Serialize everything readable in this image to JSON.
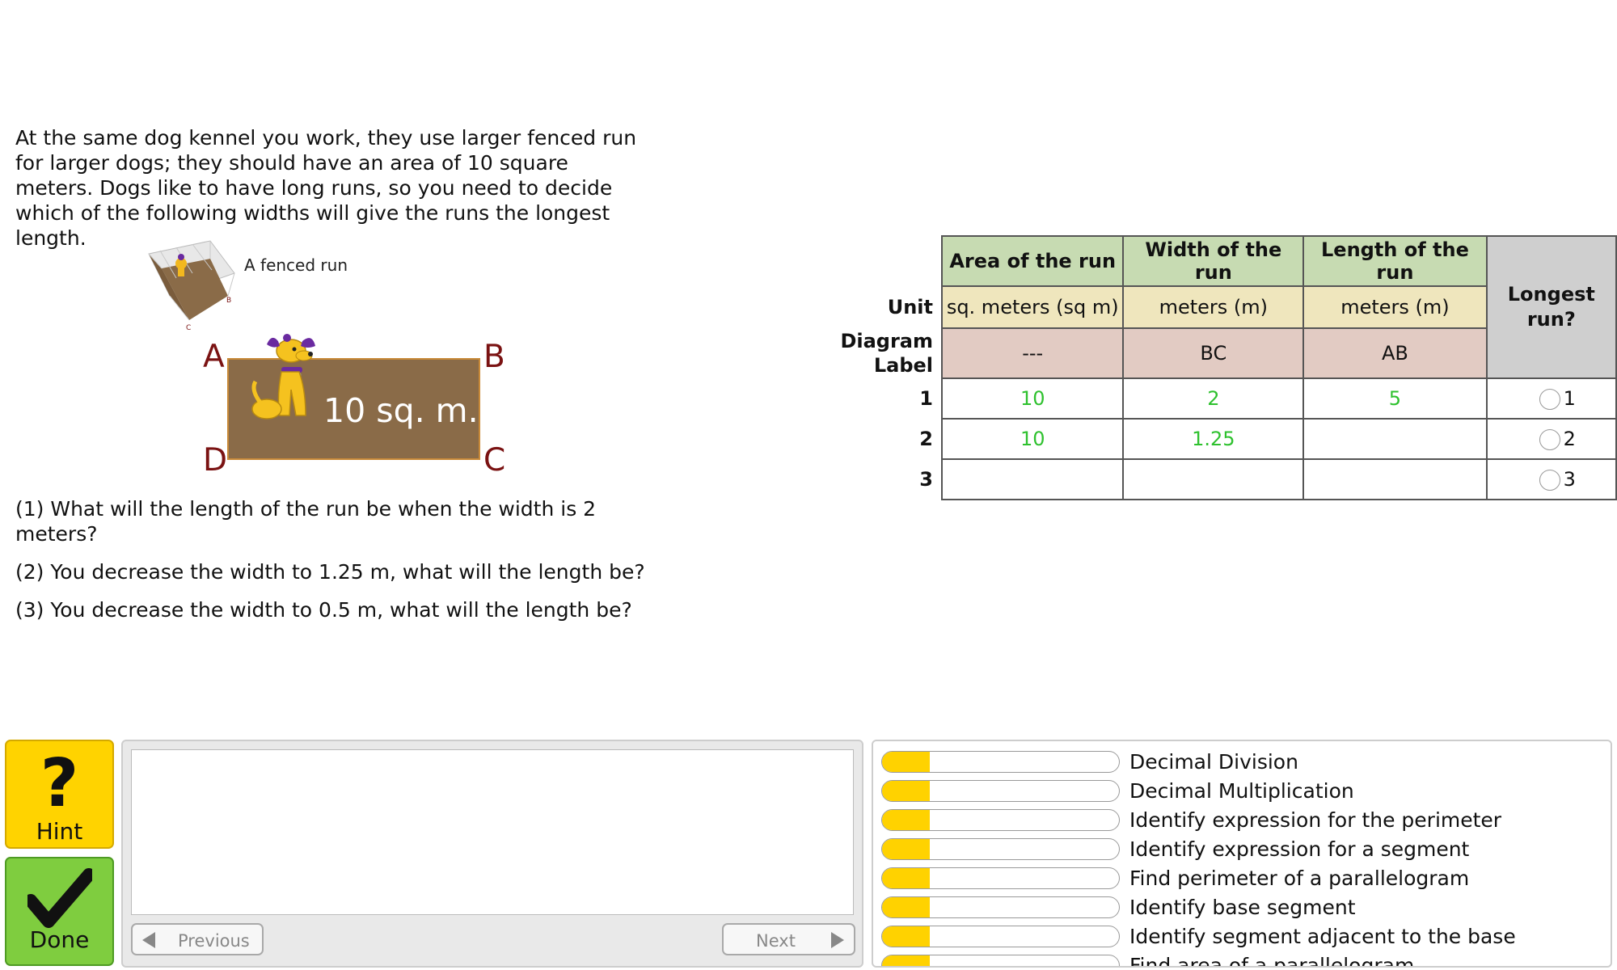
{
  "problem": {
    "intro": "At the same dog kennel you work, they use larger fenced run for larger dogs; they should have an area of 10 square meters. Dogs like to have long runs, so you need to decide which of the following widths will give the runs the longest length.",
    "thumbnail_caption": "A fenced run",
    "diagram": {
      "area_label": "10 sq. m.",
      "corners": {
        "a": "A",
        "b": "B",
        "c": "C",
        "d": "D"
      }
    },
    "questions": [
      "(1) What will the length of the run be when the width is 2 meters?",
      "(2) You decrease the width to 1.25 m, what will the length be?",
      "(3) You decrease the width to 0.5 m, what will the length be?"
    ]
  },
  "table": {
    "headers": {
      "area": "Area of the run",
      "width": "Width of the run",
      "length": "Length of the run",
      "longest": "Longest run?"
    },
    "unit_label": "Unit",
    "units": {
      "area": "sq. meters (sq m)",
      "width": "meters (m)",
      "length": "meters (m)"
    },
    "diagram_label": "Diagram Label",
    "diagram": {
      "area": "---",
      "width": "BC",
      "length": "AB"
    },
    "rows": [
      {
        "n": "1",
        "area": "10",
        "width": "2",
        "length": "5",
        "radio": "1"
      },
      {
        "n": "2",
        "area": "10",
        "width": "1.25",
        "length": "",
        "radio": "2"
      },
      {
        "n": "3",
        "area": "",
        "width": "",
        "length": "",
        "radio": "3"
      }
    ]
  },
  "controls": {
    "hint_icon": "?",
    "hint_label": "Hint",
    "done_label": "Done",
    "previous_label": "Previous",
    "next_label": "Next"
  },
  "skills": [
    {
      "name": "Decimal Division",
      "progress": 0.2
    },
    {
      "name": "Decimal Multiplication",
      "progress": 0.2
    },
    {
      "name": "Identify expression for the perimeter",
      "progress": 0.2
    },
    {
      "name": "Identify expression for a segment",
      "progress": 0.2
    },
    {
      "name": "Find perimeter of a parallelogram",
      "progress": 0.2
    },
    {
      "name": "Identify base segment",
      "progress": 0.2
    },
    {
      "name": "Identify segment adjacent to the base",
      "progress": 0.2
    },
    {
      "name": "Find area of a parallelogram",
      "progress": 0.2
    }
  ],
  "colors": {
    "hint": "#ffd300",
    "done": "#7fcd3f",
    "skill_fill": "#ffd200",
    "entered_value": "#2ec12e"
  }
}
